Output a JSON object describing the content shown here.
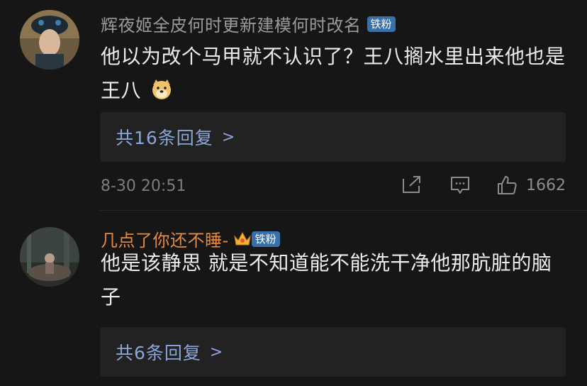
{
  "comments": [
    {
      "username": "辉夜姬全皮何时更新建模何时改名",
      "badge": "铁粉",
      "text": "他以为改个马甲就不认识了？王八搁水里出来他也是王八",
      "emoji": "doge-emoji",
      "replies_label": "共16条回复",
      "timestamp": "8-30 20:51",
      "like_count": "1662"
    },
    {
      "username": "几点了你还不睡-",
      "badge": "铁粉",
      "text": "他是该静思 就是不知道能不能洗干净他那肮脏的脑子",
      "replies_label": "共6条回复"
    }
  ],
  "colors": {
    "background": "#161616",
    "username_muted": "#9a9a9a",
    "username_orange": "#e58a3c",
    "badge_blue": "#3a6fa8",
    "reply_link": "#8aa6d8"
  },
  "icons": [
    "share-icon",
    "comment-icon",
    "like-icon",
    "crown-icon"
  ]
}
